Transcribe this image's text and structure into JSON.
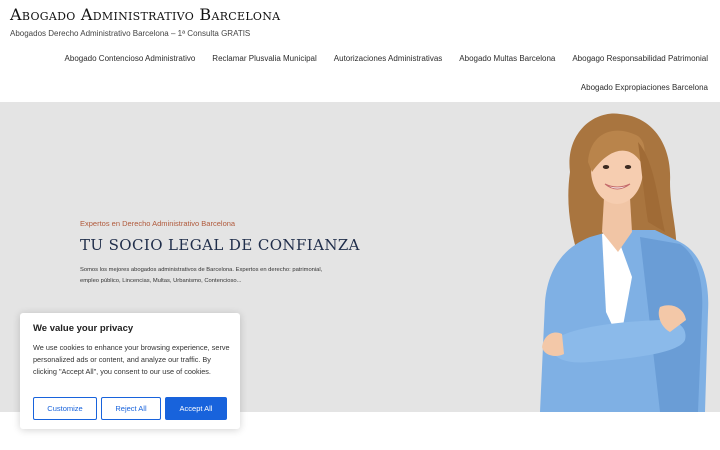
{
  "header": {
    "site_title": "Abogado Administrativo Barcelona",
    "tagline": "Abogados Derecho Administrativo Barcelona – 1ª Consulta GRATIS"
  },
  "nav": {
    "items": [
      "Abogado Contencioso Administrativo",
      "Reclamar Plusvalia Municipal",
      "Autorizaciones Administrativas",
      "Abogado Multas Barcelona",
      "Abogago Responsabilidad Patrimonial",
      "Abogado Expropiaciones Barcelona"
    ]
  },
  "hero": {
    "kicker": "Expertos en Derecho Administrativo Barcelona",
    "title": "TU SOCIO LEGAL DE CONFIANZA",
    "description": "Somos los mejores abogados administrativos de Barcelona. Expertos en derecho: patrimonial, empleo público, Lincencias, Multas, Urbanismo, Contencioso...",
    "image_icon": "businesswoman-portrait"
  },
  "cookie_banner": {
    "title": "We value your privacy",
    "text": "We use cookies to enhance your browsing experience, serve personalized ads or content, and analyze our traffic. By clicking \"Accept All\", you consent to our use of cookies.",
    "customize_label": "Customize",
    "reject_label": "Reject All",
    "accept_label": "Accept All",
    "accent_color": "#1863dc"
  },
  "colors": {
    "hero_bg": "#e4e4e4",
    "kicker": "#b05a3c",
    "title": "#1f2d4a"
  }
}
